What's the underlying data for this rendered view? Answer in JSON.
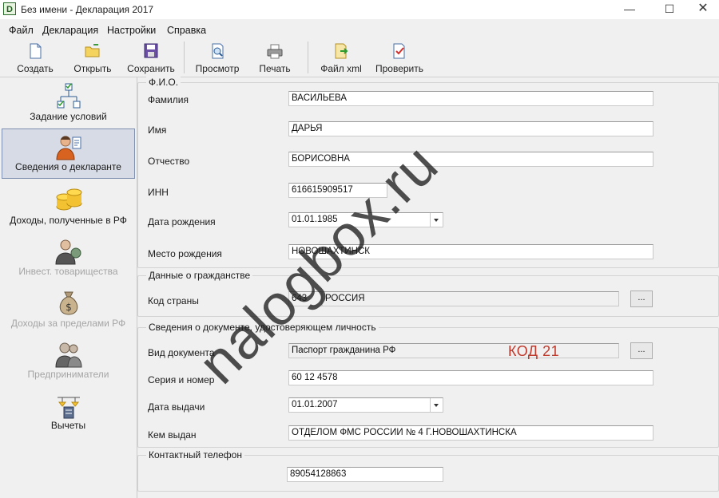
{
  "window": {
    "title": "Без имени - Декларация 2017",
    "app_icon_letter": "D",
    "minimize": "—",
    "maximize": "☐",
    "close": "✕"
  },
  "menu": [
    "Файл",
    "Декларация",
    "Настройки",
    "Справка"
  ],
  "toolbar": {
    "create": "Создать",
    "open": "Открыть",
    "save": "Сохранить",
    "preview": "Просмотр",
    "print": "Печать",
    "file_xml": "Файл xml",
    "check": "Проверить"
  },
  "sidebar": {
    "items": [
      {
        "label": "Задание условий",
        "icon": "conditions-tree-icon",
        "state": "enabled"
      },
      {
        "label": "Сведения о декларанте",
        "icon": "declarant-person-icon",
        "state": "active"
      },
      {
        "label": "Доходы, полученные в РФ",
        "icon": "coins-icon",
        "state": "enabled"
      },
      {
        "label": "Инвест. товарищества",
        "icon": "investor-icon",
        "state": "disabled"
      },
      {
        "label": "Доходы за пределами РФ",
        "icon": "money-bag-icon",
        "state": "disabled"
      },
      {
        "label": "Предприниматели",
        "icon": "businessman-icon",
        "state": "disabled"
      },
      {
        "label": "Вычеты",
        "icon": "deductions-icon",
        "state": "enabled"
      }
    ]
  },
  "fio": {
    "title": "Ф.И.О.",
    "surname_label": "Фамилия",
    "surname": "ВАСИЛЬЕВА",
    "name_label": "Имя",
    "name": "ДАРЬЯ",
    "patronymic_label": "Отчество",
    "patronymic": "БОРИСОВНА",
    "inn_label": "ИНН",
    "inn": "616615909517",
    "birthdate_label": "Дата рождения",
    "birthdate": "01.01.1985",
    "birthplace_label": "Место рождения",
    "birthplace": "НОВОШАХТИНСК"
  },
  "citizenship": {
    "title": "Данные о гражданстве",
    "country_label": "Код страны",
    "country_code": "643",
    "country_name": "РОССИЯ",
    "browse": "..."
  },
  "document": {
    "title": "Сведения о документе, удостоверяющем личность",
    "type_label": "Вид документа",
    "type": "Паспорт гражданина РФ",
    "browse": "...",
    "series_label": "Серия и номер",
    "series": "60 12 4578",
    "issue_date_label": "Дата выдачи",
    "issue_date": "01.01.2007",
    "issued_by_label": "Кем выдан",
    "issued_by": "ОТДЕЛОМ ФМС РОССИИ № 4 Г.НОВОШАХТИНСКА",
    "annotation": "КОД 21"
  },
  "contact": {
    "title": "Контактный телефон",
    "phone": "89054128863"
  },
  "watermark": "nalogbox.ru",
  "colors": {
    "annotation": "#c0392b",
    "active_bg": "#d7dbe5"
  }
}
